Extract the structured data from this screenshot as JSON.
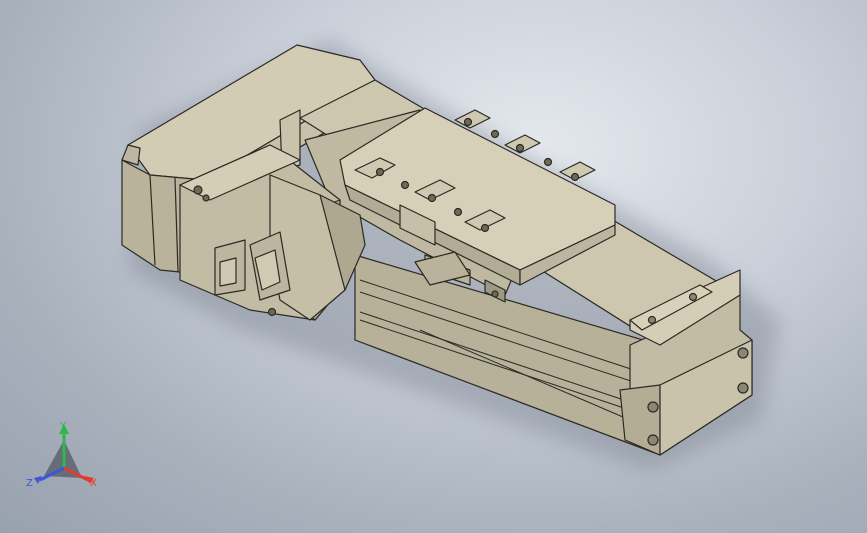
{
  "viewport": {
    "background_top": "#e4e8ee",
    "background_bottom": "#98a1ae"
  },
  "model": {
    "body_color": "#c2bca4",
    "edge_color": "#2b2a24",
    "shade_light": "#d2ccb5",
    "shade_dark": "#a9a38c",
    "shadow_color": "#6b7280"
  },
  "triad": {
    "x_label": "X",
    "y_label": "Y",
    "z_label": "Z",
    "x_color": "#e33b2e",
    "y_color": "#2fb84a",
    "z_color": "#3b57d6"
  }
}
